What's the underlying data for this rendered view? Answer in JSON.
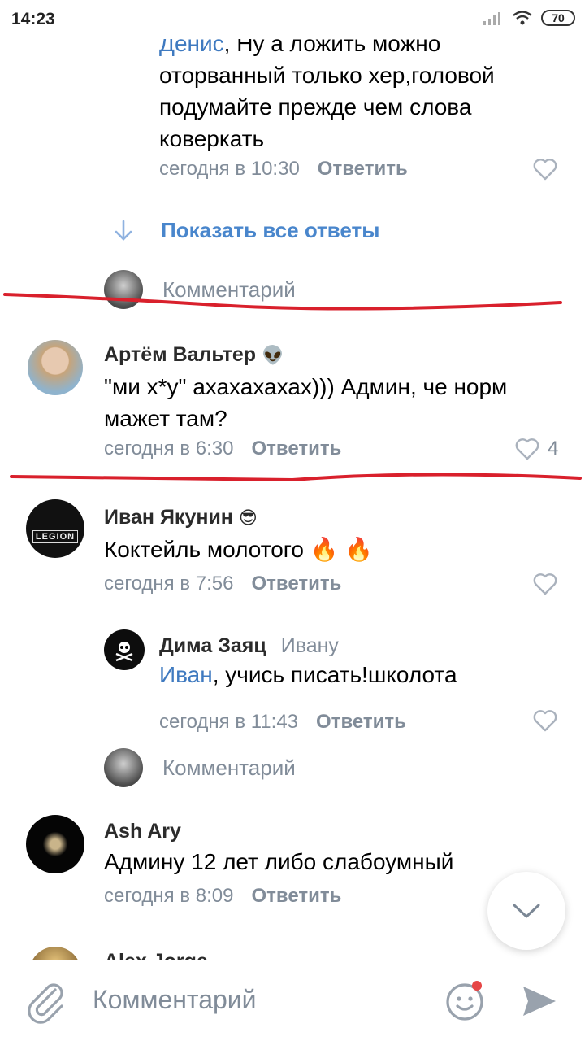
{
  "status_bar": {
    "time": "14:23",
    "battery": "70"
  },
  "thread_top": {
    "mention": "Денис",
    "text_rest": ", Ну а ложить можно оторванный только хер,головой подумайте прежде чем слова коверкать",
    "time": "сегодня в 10:30",
    "reply_label": "Ответить"
  },
  "show_all_replies": "Показать все ответы",
  "comment_stub_1": "Комментарий",
  "comments": [
    {
      "name": "Артём Вальтер",
      "emoji": "👽",
      "text": "\"ми х*у\" ахахахахах))) Админ, че норм мажет там?",
      "time": "сегодня в 6:30",
      "reply_label": "Ответить",
      "likes": "4"
    },
    {
      "name": "Иван Якунин",
      "emoji": "😎",
      "text": "Коктейль молотого 🔥 🔥",
      "time": "сегодня в 7:56",
      "reply_label": "Ответить",
      "avatar_text": "LEGION"
    },
    {
      "name": "Дима Заяц",
      "reply_to": "Ивану",
      "mention": "Иван",
      "text_rest": ", учись писать!школота",
      "time": "сегодня в 11:43",
      "reply_label": "Ответить"
    },
    {
      "name": "Ash Ary",
      "text": "Админу 12 лет либо слабоумный",
      "time": "сегодня в 8:09",
      "reply_label": "Ответить"
    },
    {
      "name": "Alex Jorge"
    }
  ],
  "comment_stub_2": "Комментарий",
  "composer": {
    "placeholder": "Комментарий"
  },
  "colors": {
    "accent": "#4986cc",
    "secondary_text": "#818c99",
    "annotation_red": "#d9202c"
  }
}
